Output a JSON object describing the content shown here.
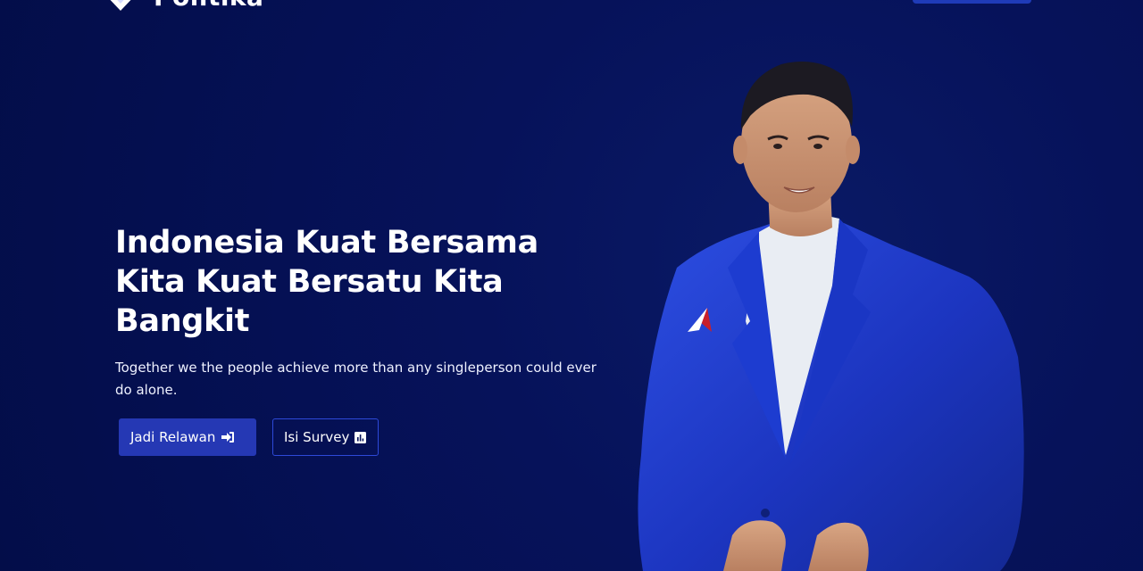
{
  "header": {
    "logo_text": "Politika",
    "nav_cta_label": ""
  },
  "hero": {
    "title": "Indonesia Kuat Bersama Kita Kuat Bersatu Kita Bangkit",
    "subtitle": "Together we the people achieve more than any singleperson could ever do alone."
  },
  "actions": {
    "primary_label": "Jadi Relawan",
    "primary_icon": "sign-in-icon",
    "secondary_label": "Isi Survey",
    "secondary_icon": "bar-chart-icon"
  },
  "colors": {
    "background": "#040f4f",
    "accent": "#2538b4",
    "text": "#ffffff"
  }
}
